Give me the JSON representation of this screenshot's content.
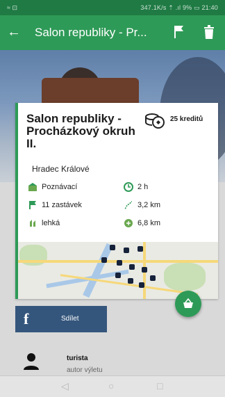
{
  "status_bar": {
    "left": "≈ ⊡",
    "right": "347.1K/s ⇡ .ıl 9% ▭ 21:40"
  },
  "app_bar": {
    "title": "Salon republiky - Pr...",
    "icons": [
      "back-arrow-icon",
      "flag-icon",
      "trash-icon"
    ]
  },
  "route": {
    "name": "Salon republiky - Procházkový okruh II.",
    "credits": "25 kreditů",
    "city": "Hradec Králové",
    "stats": [
      {
        "icon": "category-icon",
        "value": "Poznávací"
      },
      {
        "icon": "clock-icon",
        "value": "2 h"
      },
      {
        "icon": "flag-icon",
        "value": "11 zastávek"
      },
      {
        "icon": "route-icon",
        "value": "3,2 km"
      },
      {
        "icon": "difficulty-icon",
        "value": "lehká"
      },
      {
        "icon": "distance-icon",
        "value": "6,8 km"
      }
    ]
  },
  "share": {
    "label": "Sdílet",
    "icon": "facebook-icon"
  },
  "author": {
    "name": "turista",
    "role": "autor výletu"
  },
  "colors": {
    "primary": "#2e9a57",
    "facebook": "#35567c"
  }
}
